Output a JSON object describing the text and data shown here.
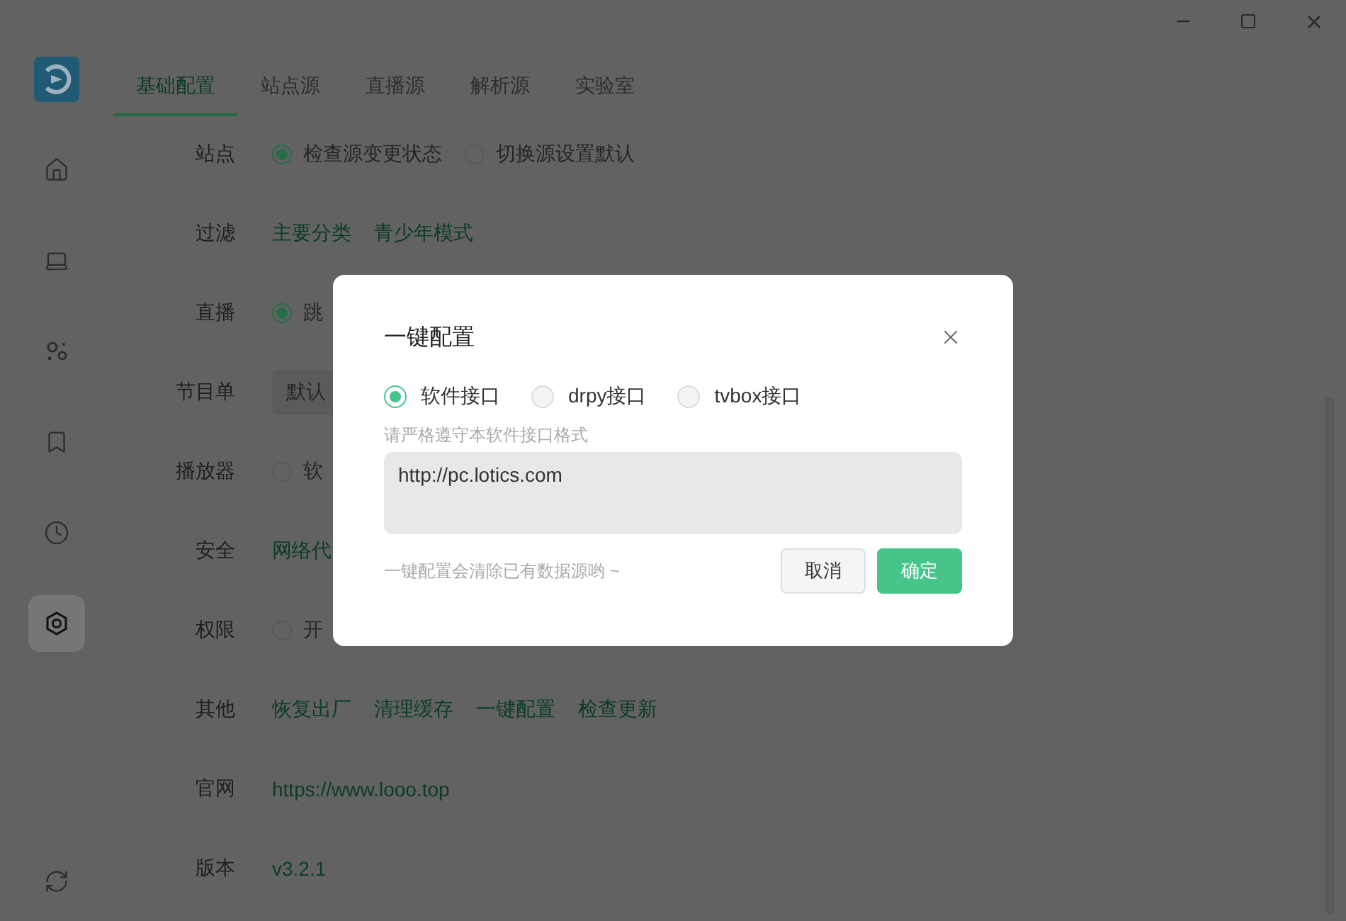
{
  "sidebar": {
    "items": [
      {
        "kind": "home",
        "selected": false
      },
      {
        "kind": "laptop",
        "selected": false
      },
      {
        "kind": "dots",
        "selected": false
      },
      {
        "kind": "bookmark",
        "selected": false
      },
      {
        "kind": "clock",
        "selected": false
      },
      {
        "kind": "settings",
        "selected": true
      },
      {
        "kind": "sync",
        "selected": false
      }
    ]
  },
  "tabs": [
    {
      "label": "基础配置",
      "selected": true
    },
    {
      "label": "站点源",
      "selected": false
    },
    {
      "label": "直播源",
      "selected": false
    },
    {
      "label": "解析源",
      "selected": false
    },
    {
      "label": "实验室",
      "selected": false
    }
  ],
  "settings": [
    {
      "label": "站点",
      "kind": "radio",
      "options": [
        {
          "label": "检查源变更状态",
          "selected": true
        },
        {
          "label": "切换源设置默认",
          "selected": false
        }
      ]
    },
    {
      "label": "过滤",
      "kind": "links",
      "links": [
        "主要分类",
        "青少年模式"
      ]
    },
    {
      "label": "直播",
      "kind": "radio",
      "options": [
        {
          "label": "跳",
          "selected": true
        }
      ]
    },
    {
      "label": "节目单",
      "kind": "select",
      "value": "默认"
    },
    {
      "label": "播放器",
      "kind": "radio",
      "options": [
        {
          "label": "软",
          "selected": false
        }
      ]
    },
    {
      "label": "安全",
      "kind": "links",
      "links": [
        "网络代"
      ]
    },
    {
      "label": "权限",
      "kind": "radio",
      "options": [
        {
          "label": "开",
          "selected": false
        }
      ]
    },
    {
      "label": "其他",
      "kind": "links",
      "links": [
        "恢复出厂",
        "清理缓存",
        "一键配置",
        "检查更新"
      ]
    },
    {
      "label": "官网",
      "kind": "links",
      "links": [
        "https://www.looo.top"
      ]
    },
    {
      "label": "版本",
      "kind": "links",
      "links": [
        "v3.2.1"
      ]
    }
  ],
  "dialog": {
    "title": "一键配置",
    "options": [
      {
        "label": "软件接口",
        "selected": true
      },
      {
        "label": "drpy接口",
        "selected": false
      },
      {
        "label": "tvbox接口",
        "selected": false
      }
    ],
    "hint": "请严格遵守本软件接口格式",
    "value": "http://pc.lotics.com",
    "note": "一键配置会清除已有数据源哟 ~",
    "buttons": [
      {
        "label": "取消",
        "kind": "secondary"
      },
      {
        "label": "确定",
        "kind": "primary"
      }
    ]
  }
}
